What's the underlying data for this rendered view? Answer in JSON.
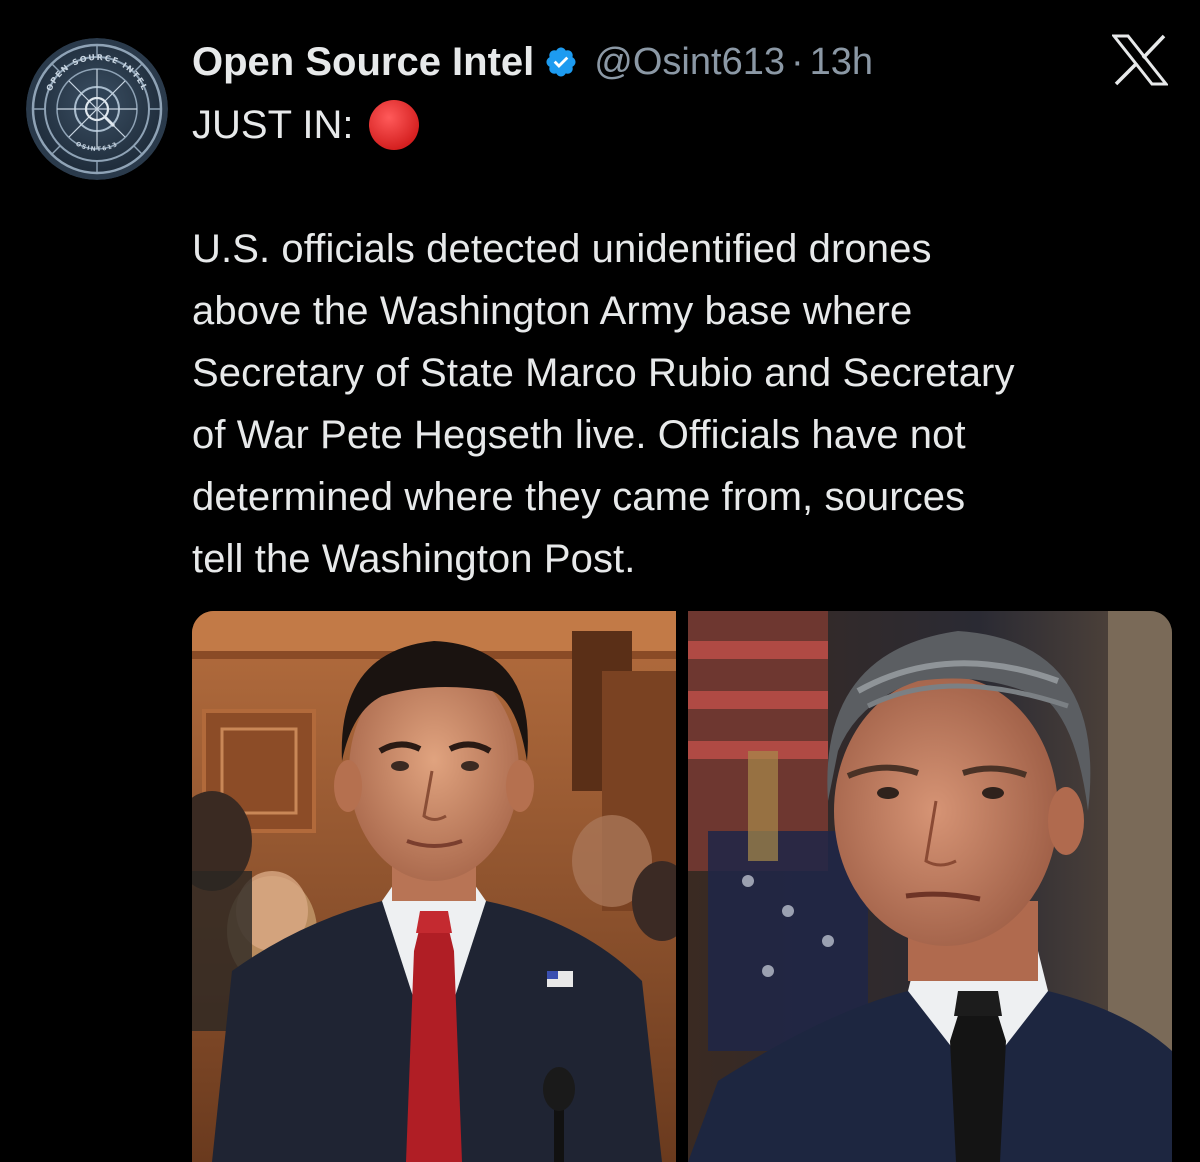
{
  "tweet": {
    "display_name": "Open Source Intel",
    "handle": "@Osint613",
    "separator": "·",
    "time": "13h",
    "lead": "JUST IN:",
    "lead_emoji": "red-circle-icon",
    "body_lines": [
      "U.S. officials detected unidentified drones",
      "above the Washington Army base where",
      "Secretary of State Marco Rubio and Secretary",
      "of War Pete Hegseth live. Officials have not",
      "determined where they came from, sources",
      "tell the Washington Post."
    ],
    "avatar": {
      "icon": "osint-logo-icon",
      "ring_text_top": "OPEN SOURCE INTEL",
      "ring_text_bottom": "OSINT613"
    },
    "media": [
      {
        "icon": "photo-marco-rubio"
      },
      {
        "icon": "photo-pete-hegseth"
      }
    ]
  },
  "colors": {
    "background": "#000000",
    "text": "#e7e9ea",
    "muted": "#8b98a5",
    "verified": "#1d9bf0",
    "emoji_red": "#dd2e44"
  }
}
